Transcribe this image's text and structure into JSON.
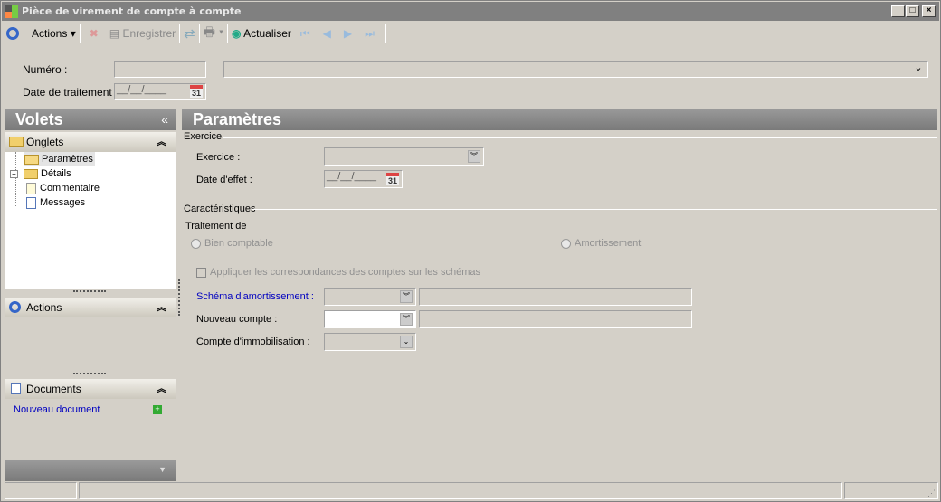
{
  "window": {
    "title": "Pièce de virement de compte à compte",
    "min": "_",
    "max": "□",
    "close": "×"
  },
  "toolbar": {
    "actions": "Actions",
    "save": "Enregistrer",
    "refresh": "Actualiser"
  },
  "header_form": {
    "numero_label": "Numéro :",
    "date_label": "Date de traitement :",
    "date_mask": "__/__/____",
    "cal_day": "31"
  },
  "sidebar": {
    "title": "Volets",
    "collapse": "«",
    "onglets": {
      "title": "Onglets",
      "items": [
        "Paramètres",
        "Détails",
        "Commentaire",
        "Messages"
      ]
    },
    "actions": {
      "title": "Actions"
    },
    "documents": {
      "title": "Documents",
      "new_doc": "Nouveau document"
    }
  },
  "main": {
    "title": "Paramètres",
    "exercice_group": "Exercice",
    "exercice_label": "Exercice :",
    "date_effet_label": "Date d'effet :",
    "date_mask": "__/__/____",
    "cal_day": "31",
    "carac_group": "Caractéristiques",
    "traitement_label": "Traitement de",
    "radio_bien": "Bien comptable",
    "radio_amort": "Amortissement",
    "checkbox_label": "Appliquer les correspondances des comptes sur les schémas",
    "schema_label": "Schéma  d'amortissement :",
    "nouveau_label": "Nouveau compte :",
    "immob_label": "Compte d'immobilisation :"
  },
  "colors": {
    "link": "#0000c0",
    "header": "#808080"
  }
}
